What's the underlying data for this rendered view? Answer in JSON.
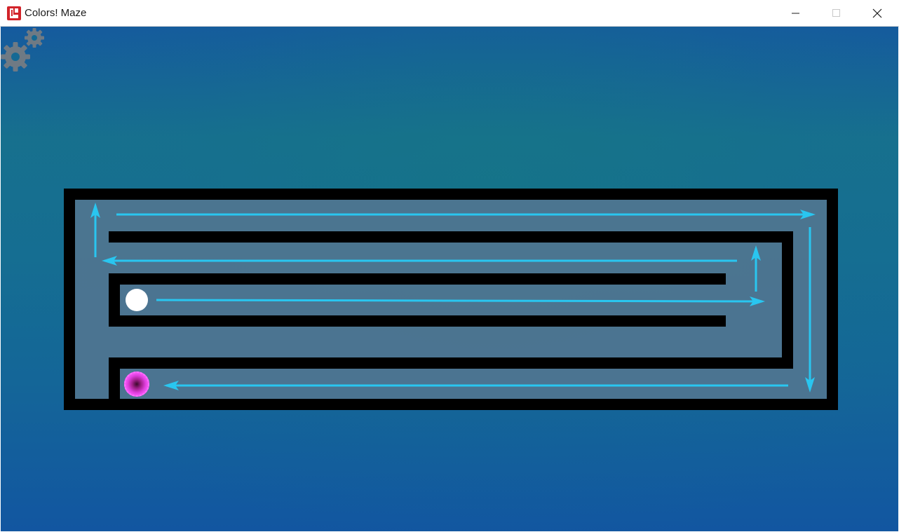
{
  "window": {
    "title": "Colors! Maze",
    "app_icon": "colors-maze-app-icon",
    "controls": [
      "minimize-icon",
      "maximize-icon",
      "close-icon"
    ]
  },
  "game": {
    "settings_icon": "gears-icon",
    "background_colors": [
      "#155a9e",
      "#17708e",
      "#1256a1"
    ],
    "maze_floor_color": "#4e7590",
    "wall_color": "#000000",
    "arrow_color": "#29c6f0",
    "player": {
      "color": "#ffffff",
      "icon": "player-ball"
    },
    "goal": {
      "color": "#e040e0",
      "icon": "goal-portal"
    }
  }
}
